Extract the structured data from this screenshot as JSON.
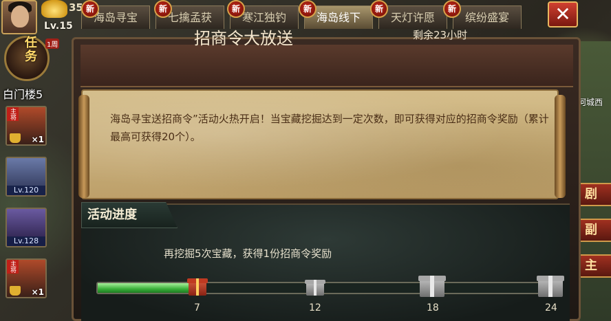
{
  "player": {
    "gold": "35",
    "level": "Lv.15",
    "task_label": "任务",
    "task_sub": "1周",
    "location": "白门楼5"
  },
  "heroes": [
    {
      "badge": "主将",
      "label": "×1",
      "type": "count"
    },
    {
      "badge": "",
      "label": "Lv.120",
      "type": "level"
    },
    {
      "badge": "",
      "label": "Lv.128",
      "type": "level"
    },
    {
      "badge": "主将",
      "label": "×1",
      "type": "count"
    }
  ],
  "tabs": [
    {
      "label": "海岛寻宝",
      "badge": "新",
      "active": false
    },
    {
      "label": "七擒孟获",
      "badge": "新",
      "active": false
    },
    {
      "label": "寒江独钓",
      "badge": "新",
      "active": false
    },
    {
      "label": "海岛线下",
      "badge": "新",
      "active": true
    },
    {
      "label": "天灯许愿",
      "badge": "新",
      "active": false
    },
    {
      "label": "缤纷盛宴",
      "badge": "新",
      "active": false
    }
  ],
  "close_label": "✕",
  "right_side": {
    "city_name": "河城西",
    "buttons": [
      "剧",
      "副",
      "主"
    ]
  },
  "panel": {
    "title": "招商令大放送",
    "timer": "剩余23小时",
    "description": "海岛寻宝送招商令”活动火热开启！当宝藏挖掘达到一定次数，即可获得对应的招商令奖励（累计最高可获得20个）。",
    "section_label": "活动进度",
    "progress_message": "再挖掘5次宝藏，获得1份招商令奖励"
  },
  "progress": {
    "current": 7,
    "max": 24,
    "fill_fraction": 0.22,
    "milestones": [
      {
        "value": "7",
        "gift": "red"
      },
      {
        "value": "12",
        "gift": "grey"
      },
      {
        "value": "18",
        "gift": "grey"
      },
      {
        "value": "24",
        "gift": "grey"
      }
    ]
  }
}
